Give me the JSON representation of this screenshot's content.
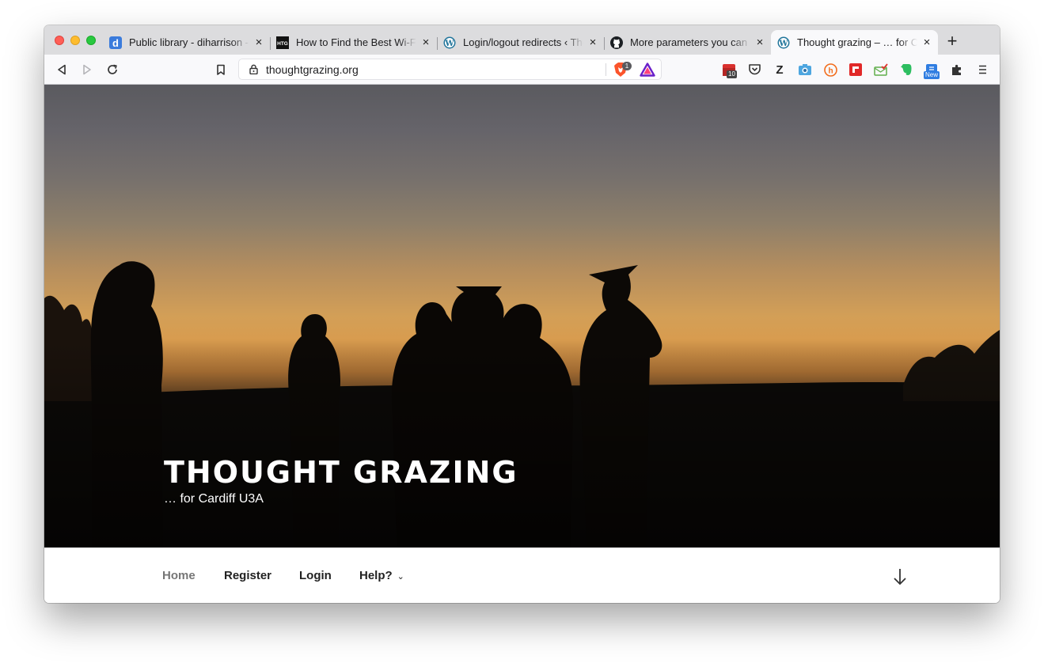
{
  "browser": {
    "tabs": [
      {
        "title": "Public library - diharrison -",
        "favicon": "d-icon",
        "active": false
      },
      {
        "title": "How to Find the Best Wi-Fi",
        "favicon": "htg-icon",
        "active": false
      },
      {
        "title": "Login/logout redirects ‹ Tho",
        "favicon": "wordpress-icon",
        "active": false
      },
      {
        "title": "More parameters you can u",
        "favicon": "github-icon",
        "active": false
      },
      {
        "title": "Thought grazing – … for Ca",
        "favicon": "wordpress-icon",
        "active": true
      }
    ],
    "url": "thoughtgrazing.org",
    "extension_badges": {
      "brave_shields": "1",
      "calendar": "10",
      "new": "New"
    },
    "colors": {
      "tabbar": "#dcdcde",
      "toolbar": "#f9f9fb"
    }
  },
  "site": {
    "title": "THOUGHT GRAZING",
    "description": "… for Cardiff U3A",
    "nav": [
      {
        "label": "Home",
        "current": true
      },
      {
        "label": "Register"
      },
      {
        "label": "Login"
      },
      {
        "label": "Help?",
        "has_submenu": true
      }
    ],
    "colors": {
      "title": "#ffffff",
      "nav_text": "#222222",
      "nav_current": "#767676"
    }
  }
}
